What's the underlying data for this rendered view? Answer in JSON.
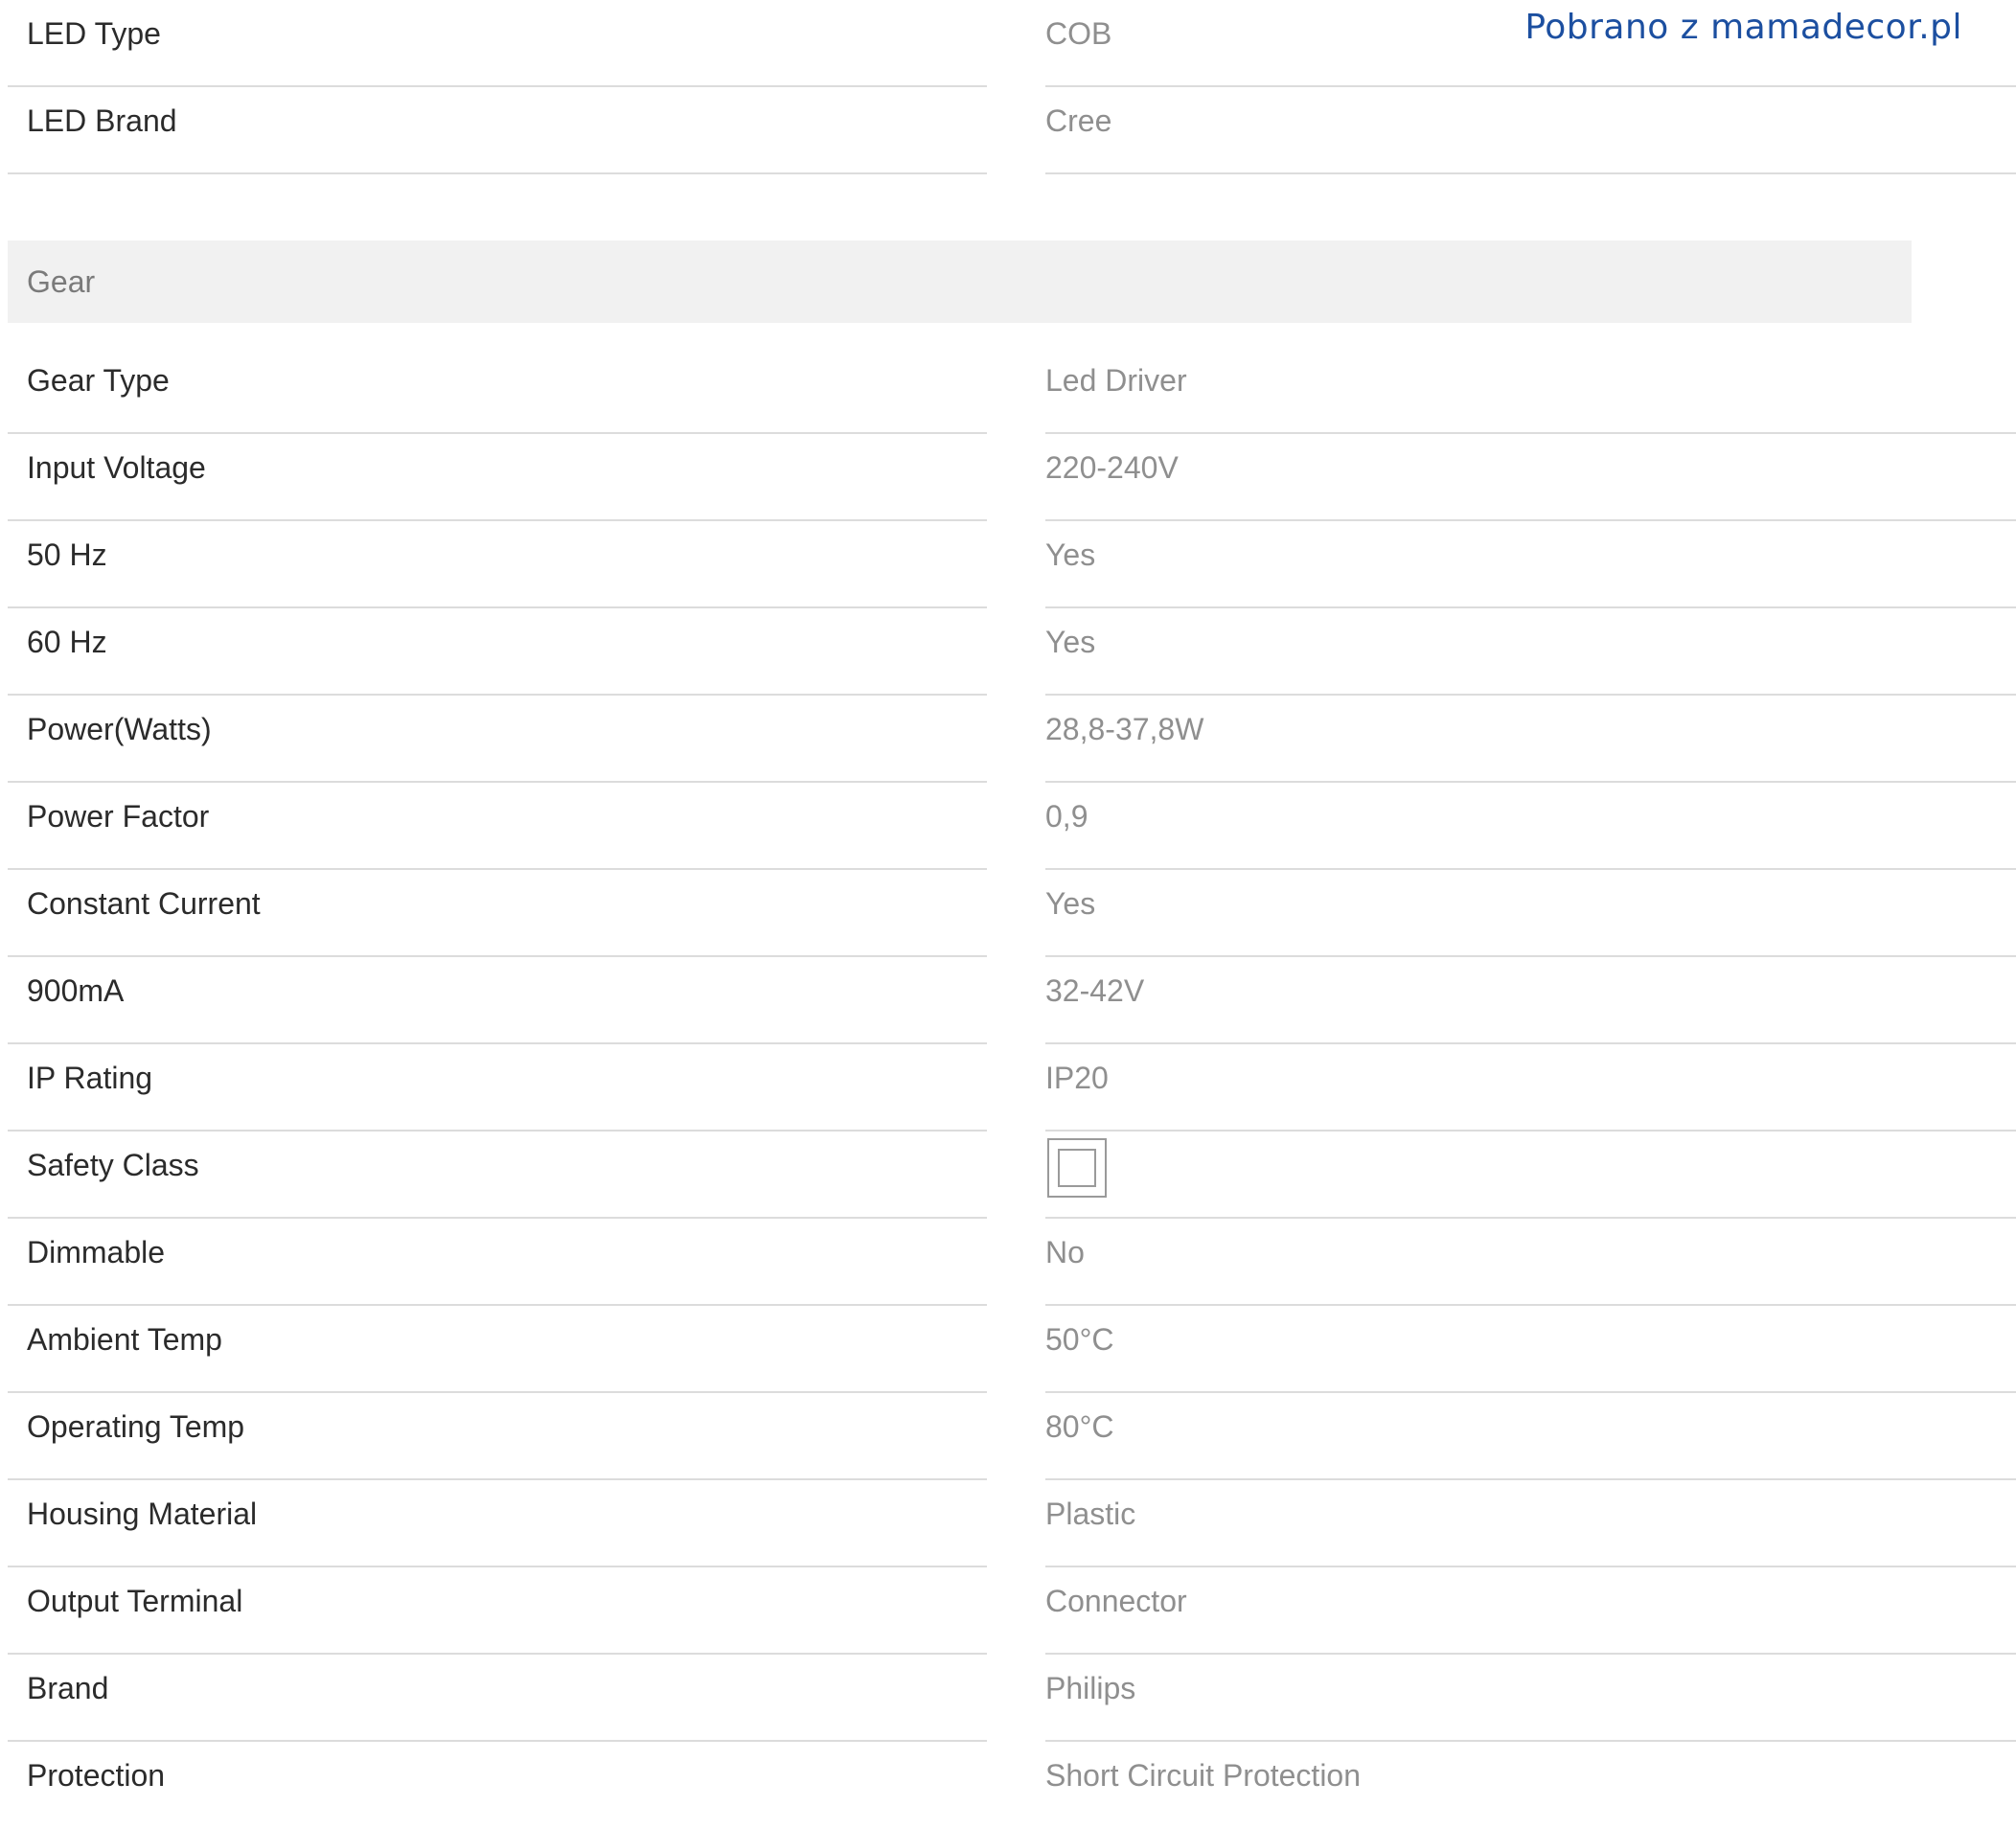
{
  "watermark": "Pobrano z mamadecor.pl",
  "top_rows": [
    {
      "label": "LED Type",
      "value": "COB"
    },
    {
      "label": "LED Brand",
      "value": "Cree"
    }
  ],
  "gear": {
    "title": "Gear",
    "rows": [
      {
        "label": "Gear Type",
        "value": "Led Driver"
      },
      {
        "label": "Input Voltage",
        "value": "220-240V"
      },
      {
        "label": "50 Hz",
        "value": "Yes"
      },
      {
        "label": "60 Hz",
        "value": "Yes"
      },
      {
        "label": "Power(Watts)",
        "value": "28,8-37,8W"
      },
      {
        "label": "Power Factor",
        "value": "0,9"
      },
      {
        "label": "Constant Current",
        "value": "Yes"
      },
      {
        "label": "900mA",
        "value": "32-42V"
      },
      {
        "label": "IP Rating",
        "value": "IP20"
      },
      {
        "label": "Safety Class",
        "value_icon": "class-ii-double-square-icon"
      },
      {
        "label": "Dimmable",
        "value": "No"
      },
      {
        "label": "Ambient Temp",
        "value": "50°C"
      },
      {
        "label": "Operating Temp",
        "value": "80°C"
      },
      {
        "label": "Housing Material",
        "value": "Plastic"
      },
      {
        "label": "Output Terminal",
        "value": "Connector"
      },
      {
        "label": "Brand",
        "value": "Philips"
      },
      {
        "label": "Protection",
        "value": "Short Circuit Protection"
      }
    ]
  },
  "colors": {
    "label": "#2b2b2b",
    "value": "#8f8f8f",
    "divider": "#dcdcdc",
    "section_bg": "#f1f1f1",
    "watermark": "#1c4fa0"
  }
}
